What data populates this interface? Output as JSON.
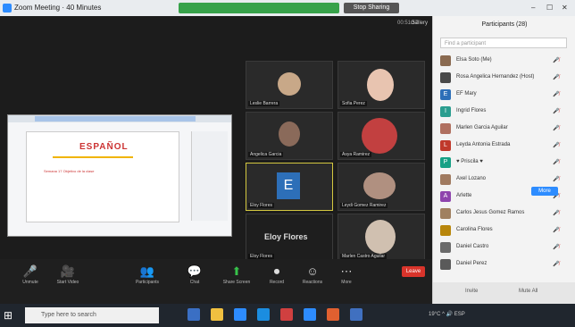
{
  "window": {
    "title": "Zoom Meeting · 40 Minutes",
    "stop_share": "Stop Sharing"
  },
  "meeting": {
    "timer": "00:51:57",
    "view_label": "Gallery",
    "speaker_name": "Eloy Flores",
    "tiles": [
      {
        "name": "Leslie Barrera",
        "face": "#c8a888"
      },
      {
        "name": "Sofia Perez",
        "face": "#e8c4b0"
      },
      {
        "name": "Angelica Garcia",
        "face": "#8a6a5a"
      },
      {
        "name": "Asya Ramirez",
        "face": "#c24040"
      },
      {
        "name": "Eloy Flores",
        "face": "#2d6fb8"
      },
      {
        "name": "Leydi Gomez Ramirez",
        "face": "#b09080"
      },
      {
        "name": "Eloy Flores",
        "face": "#2a2a2a"
      },
      {
        "name": "Marlen Castro Aguilar",
        "face": "#d0c0b0"
      }
    ],
    "letter_avatar": "E",
    "shared_heading": "ESPAÑOL",
    "shared_text": "Semana 17 Objetivo de la clase"
  },
  "toolbar": {
    "items": [
      {
        "icon": "🎤",
        "label": "Unmute"
      },
      {
        "icon": "🎥",
        "label": "Start Video"
      },
      {
        "icon": "👥",
        "label": "Participants"
      },
      {
        "icon": "💬",
        "label": "Chat"
      },
      {
        "icon": "⬆",
        "label": "Share Screen"
      },
      {
        "icon": "⏺",
        "label": "Record"
      },
      {
        "icon": "☺",
        "label": "Reactions"
      },
      {
        "icon": "⋯",
        "label": "More"
      }
    ],
    "leave": "Leave"
  },
  "panel": {
    "title": "Participants (28)",
    "search_placeholder": "Find a participant",
    "more_button": "More",
    "footer": [
      "Invite",
      "Mute All"
    ],
    "participants": [
      {
        "name": "Elsa Soto (Me)",
        "color": "#8a6a50",
        "initial": ""
      },
      {
        "name": "Rosa Angelica Hernandez (Host)",
        "color": "#4a4a4a",
        "initial": ""
      },
      {
        "name": "EF Mary",
        "color": "#2d6fb8",
        "initial": "E"
      },
      {
        "name": "Ingrid Flores",
        "color": "#2a9d8f",
        "initial": "I"
      },
      {
        "name": "Marlen Garcia Aguilar",
        "color": "#b07060",
        "initial": ""
      },
      {
        "name": "Leyda Antonia Estrada",
        "color": "#c0392b",
        "initial": "L"
      },
      {
        "name": "♥ Priscila ♥",
        "color": "#16a085",
        "initial": "P"
      },
      {
        "name": "Axel Lozano",
        "color": "#a07a60",
        "initial": ""
      },
      {
        "name": "Arlette",
        "color": "#8e44ad",
        "initial": "A"
      },
      {
        "name": "Carlos Jesus Gomez Ramos",
        "color": "#a08060",
        "initial": ""
      },
      {
        "name": "Carolina Flores",
        "color": "#b8860b",
        "initial": ""
      },
      {
        "name": "Daniel Castro",
        "color": "#6a6a6a",
        "initial": ""
      },
      {
        "name": "Daniel Perez",
        "color": "#5a5a5a",
        "initial": ""
      }
    ]
  },
  "taskbar": {
    "search_placeholder": "Type here to search",
    "clock": "19°C  ^ 🔊 ESP"
  }
}
